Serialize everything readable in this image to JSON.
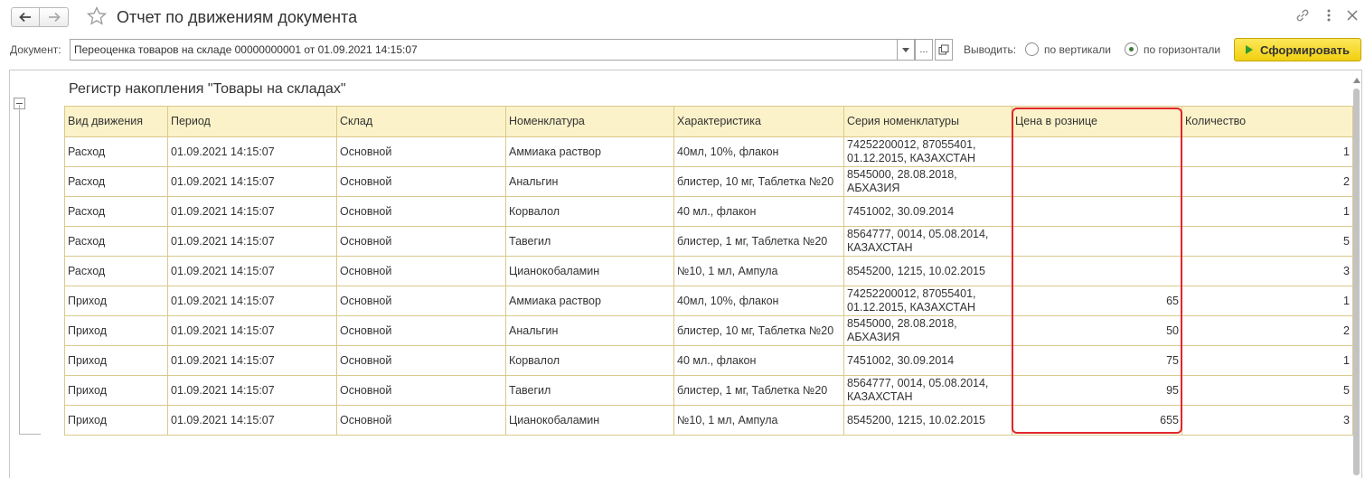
{
  "window": {
    "title": "Отчет по движениям документа"
  },
  "params": {
    "document_label": "Документ:",
    "document_value": "Переоценка товаров на складе 00000000001 от 01.09.2021 14:15:07",
    "dots_label": "...",
    "output_label": "Выводить:",
    "vertical_label": "по вертикали",
    "horizontal_label": "по горизонтали",
    "selected_output": "по горизонтали",
    "generate_label": "Сформировать"
  },
  "report": {
    "title": "Регистр накопления \"Товары на складах\"",
    "columns": [
      "Вид движения",
      "Период",
      "Склад",
      "Номенклатура",
      "Характеристика",
      "Серия номенклатуры",
      "Цена в рознице",
      "Количество"
    ],
    "rows": [
      {
        "kind": "Расход",
        "period": "01.09.2021 14:15:07",
        "warehouse": "Основной",
        "item": "Аммиака раствор",
        "characteristic": "40мл, 10%, флакон",
        "series": "74252200012, 87055401, 01.12.2015, КАЗАХСТАН",
        "price": "",
        "qty": "1"
      },
      {
        "kind": "Расход",
        "period": "01.09.2021 14:15:07",
        "warehouse": "Основной",
        "item": "Анальгин",
        "characteristic": "блистер, 10 мг, Таблетка №20",
        "series": "8545000, 28.08.2018, АБХАЗИЯ",
        "price": "",
        "qty": "2"
      },
      {
        "kind": "Расход",
        "period": "01.09.2021 14:15:07",
        "warehouse": "Основной",
        "item": "Корвалол",
        "characteristic": "40 мл., флакон",
        "series": "7451002, 30.09.2014",
        "price": "",
        "qty": "1"
      },
      {
        "kind": "Расход",
        "period": "01.09.2021 14:15:07",
        "warehouse": "Основной",
        "item": "Тавегил",
        "characteristic": "блистер, 1 мг, Таблетка №20",
        "series": "8564777, 0014, 05.08.2014, КАЗАХСТАН",
        "price": "",
        "qty": "5"
      },
      {
        "kind": "Расход",
        "period": "01.09.2021 14:15:07",
        "warehouse": "Основной",
        "item": "Цианокобаламин",
        "characteristic": "№10, 1 мл, Ампула",
        "series": "8545200, 1215, 10.02.2015",
        "price": "",
        "qty": "3"
      },
      {
        "kind": "Приход",
        "period": "01.09.2021 14:15:07",
        "warehouse": "Основной",
        "item": "Аммиака раствор",
        "characteristic": "40мл, 10%, флакон",
        "series": "74252200012, 87055401, 01.12.2015, КАЗАХСТАН",
        "price": "65",
        "qty": "1"
      },
      {
        "kind": "Приход",
        "period": "01.09.2021 14:15:07",
        "warehouse": "Основной",
        "item": "Анальгин",
        "characteristic": "блистер, 10 мг, Таблетка №20",
        "series": "8545000, 28.08.2018, АБХАЗИЯ",
        "price": "50",
        "qty": "2"
      },
      {
        "kind": "Приход",
        "period": "01.09.2021 14:15:07",
        "warehouse": "Основной",
        "item": "Корвалол",
        "characteristic": "40 мл., флакон",
        "series": "7451002, 30.09.2014",
        "price": "75",
        "qty": "1"
      },
      {
        "kind": "Приход",
        "period": "01.09.2021 14:15:07",
        "warehouse": "Основной",
        "item": "Тавегил",
        "characteristic": "блистер, 1 мг, Таблетка №20",
        "series": "8564777, 0014, 05.08.2014, КАЗАХСТАН",
        "price": "95",
        "qty": "5"
      },
      {
        "kind": "Приход",
        "period": "01.09.2021 14:15:07",
        "warehouse": "Основной",
        "item": "Цианокобаламин",
        "characteristic": "№10, 1 мл, Ампула",
        "series": "8545200, 1215, 10.02.2015",
        "price": "655",
        "qty": "3"
      }
    ]
  },
  "colors": {
    "expense_text": "#a51c1c",
    "income_text": "#2a8a2a",
    "header_bg": "#fbf2c9",
    "highlight_border": "#e0262c",
    "generate_button": "#f1cf10"
  },
  "icons": [
    "back-arrow-icon",
    "forward-arrow-icon",
    "star-icon",
    "link-icon",
    "more-icon",
    "close-icon",
    "dropdown-icon",
    "open-icon",
    "play-icon",
    "collapse-icon"
  ]
}
